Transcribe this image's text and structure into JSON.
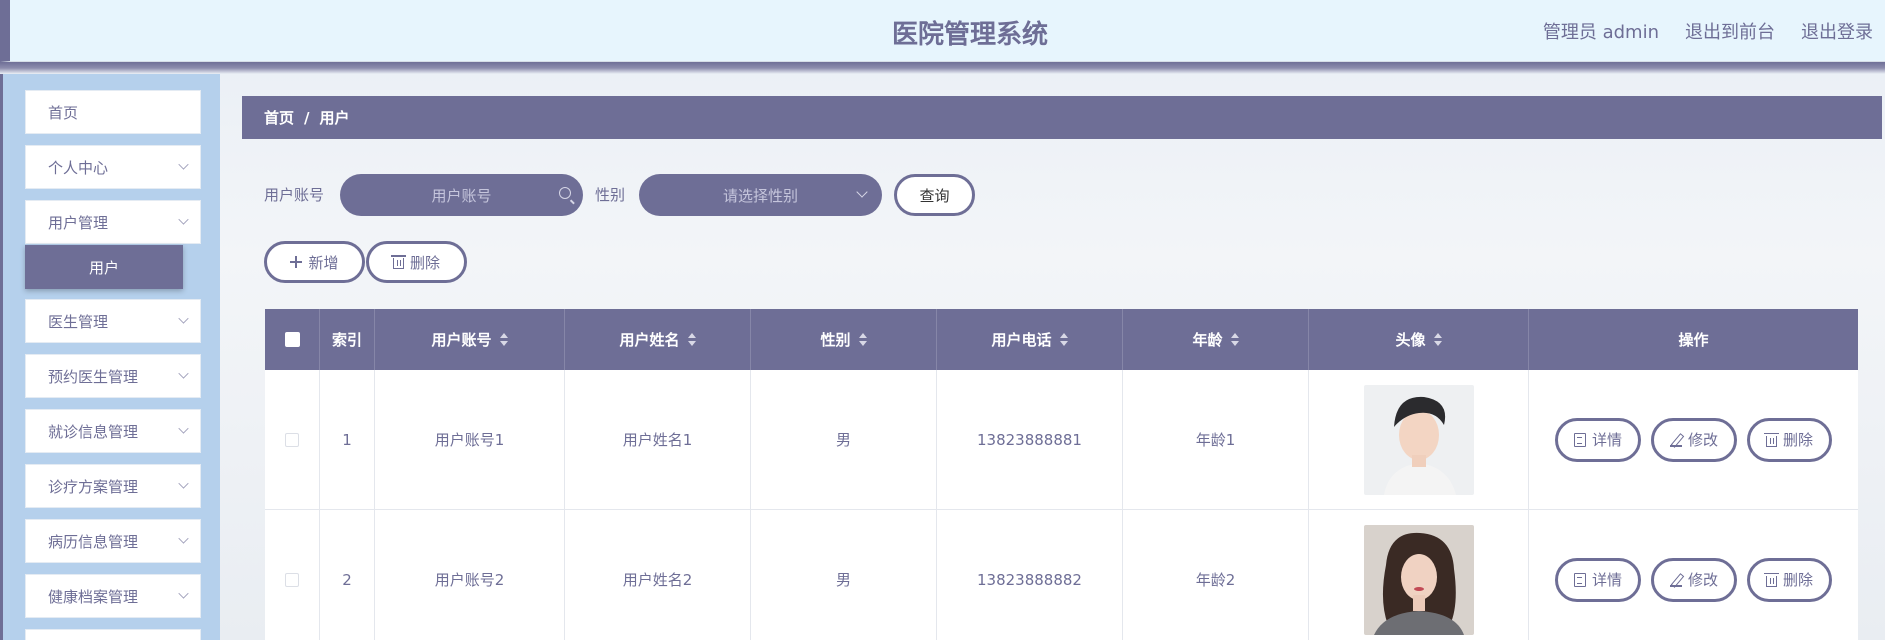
{
  "header": {
    "title": "医院管理系统",
    "links": [
      "管理员 admin",
      "退出到前台",
      "退出登录"
    ]
  },
  "sidebar": {
    "items": [
      {
        "label": "首页",
        "has_chevron": false
      },
      {
        "label": "个人中心",
        "has_chevron": true
      },
      {
        "label": "用户管理",
        "has_chevron": true
      },
      {
        "label": "医生管理",
        "has_chevron": true
      },
      {
        "label": "预约医生管理",
        "has_chevron": true
      },
      {
        "label": "就诊信息管理",
        "has_chevron": true
      },
      {
        "label": "诊疗方案管理",
        "has_chevron": true
      },
      {
        "label": "病历信息管理",
        "has_chevron": true
      },
      {
        "label": "健康档案管理",
        "has_chevron": true
      }
    ],
    "active_submenu": "用户"
  },
  "breadcrumb": {
    "home": "首页",
    "separator": "/",
    "current": "用户"
  },
  "search": {
    "account_label": "用户账号",
    "account_placeholder": "用户账号",
    "gender_label": "性别",
    "gender_placeholder": "请选择性别",
    "query_button": "查询"
  },
  "actions": {
    "add": "新增",
    "delete": "删除"
  },
  "table": {
    "headers": [
      "",
      "索引",
      "用户账号",
      "用户姓名",
      "性别",
      "用户电话",
      "年龄",
      "头像",
      "操作"
    ],
    "rows": [
      {
        "index": "1",
        "account": "用户账号1",
        "name": "用户姓名1",
        "gender": "男",
        "phone": "13823888881",
        "age": "年龄1"
      },
      {
        "index": "2",
        "account": "用户账号2",
        "name": "用户姓名2",
        "gender": "男",
        "phone": "13823888882",
        "age": "年龄2"
      }
    ],
    "row_actions": {
      "detail": "详情",
      "edit": "修改",
      "delete": "删除"
    }
  },
  "colors": {
    "accent": "#6e6e96",
    "sidebar_bg": "#b5d0ec",
    "header_bg": "#e7f5fd"
  }
}
